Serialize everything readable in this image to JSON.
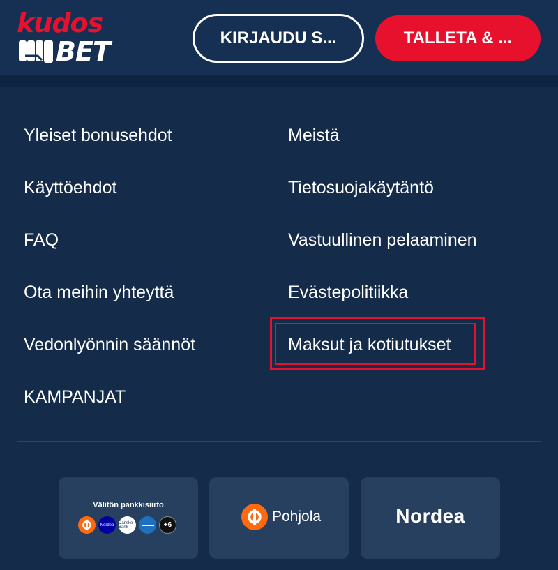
{
  "header": {
    "logo_top": "kudos",
    "logo_bottom": "BET",
    "login_label": "KIRJAUDU S...",
    "deposit_label": "TALLETA & ...",
    "brand_red": "#e8112d",
    "background": "#153052"
  },
  "footer_links": {
    "left": [
      "Yleiset bonusehdot",
      "Käyttöehdot",
      "FAQ",
      "Ota meihin yhteyttä",
      "Vedonlyönnin säännöt",
      "KAMPANJAT"
    ],
    "right": [
      "Meistä",
      "Tietosuojakäytäntö",
      "Vastuullinen pelaaminen",
      "Evästepolitiikka",
      "Maksut ja kotiutukset"
    ],
    "highlighted": "Maksut ja kotiutukset"
  },
  "payments": {
    "instant_bank_transfer": {
      "title": "Välitön pankkisiirto",
      "banks": [
        "op-icon",
        "nordea-icon",
        "danske-bank-icon",
        "saastopankki-icon"
      ],
      "bank_labels": {
        "nordea": "Nordea",
        "danske": "Danske Bank",
        "more": "+6"
      }
    },
    "pohjola_label": "Pohjola",
    "nordea_label": "Nordea"
  }
}
